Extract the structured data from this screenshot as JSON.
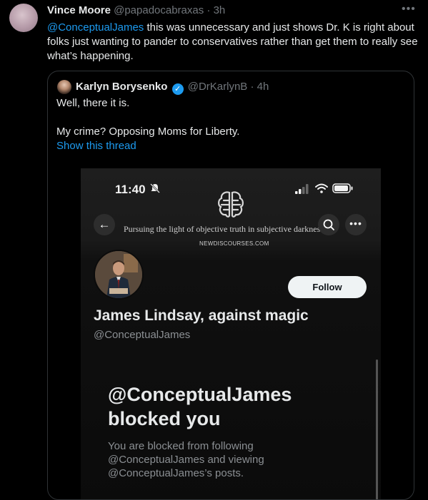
{
  "tweet": {
    "author_name": "Vince Moore",
    "author_handle": "@papadocabraxas",
    "separator": "·",
    "time": "3h",
    "more_icon": "more-horizontal-icon",
    "mention": "@ConceptualJames",
    "text": " this was unnecessary and just shows Dr. K is right about folks just wanting to pander to conservatives rather than get them to really see what’s happening."
  },
  "quote": {
    "author_name": "Karlyn Borysenko",
    "verified_icon": "verified-badge-icon",
    "author_handle": "@DrKarlynB",
    "separator": "·",
    "time": "4h",
    "line1": "Well, there it is.",
    "line2": "My crime? Opposing Moms for Liberty.",
    "show_thread": "Show this thread",
    "link_color": "#1d9bf0"
  },
  "screenshot": {
    "status_time": "11:40",
    "banner_tagline": "Pursuing the light of objective truth in subjective darkness.",
    "banner_url": "NEWDISCOURSES.COM",
    "follow_label": "Follow",
    "profile_name": "James Lindsay, against magic",
    "profile_handle": "@ConceptualJames",
    "blocked_title_line1": "@ConceptualJames",
    "blocked_title_line2": "blocked you",
    "blocked_body_line1": "You are blocked from following",
    "blocked_body_line2": "@ConceptualJames and viewing",
    "blocked_body_line3": "@ConceptualJames’s posts."
  }
}
